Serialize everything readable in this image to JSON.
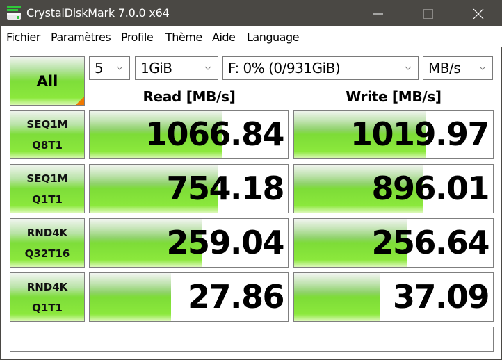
{
  "window": {
    "title": "CrystalDiskMark 7.0.0 x64",
    "controls": {
      "minimize": "minimize",
      "maximize": "maximize",
      "close": "close"
    }
  },
  "menu": [
    {
      "label": "Fichier",
      "accel": "F",
      "rest": "ichier"
    },
    {
      "label": "Paramètres",
      "accel": "P",
      "rest": "aramètres"
    },
    {
      "label": "Profile",
      "accel": "P",
      "rest": "rofile"
    },
    {
      "label": "Thème",
      "accel": "T",
      "rest": "hème"
    },
    {
      "label": "Aide",
      "accel": "A",
      "rest": "ide"
    },
    {
      "label": "Language",
      "accel": "L",
      "rest": "anguage"
    }
  ],
  "toolbar": {
    "all_button": "All",
    "test_count": "5",
    "test_size": "1GiB",
    "drive": "F: 0% (0/931GiB)",
    "unit": "MB/s"
  },
  "headers": {
    "read": "Read [MB/s]",
    "write": "Write [MB/s]"
  },
  "rows": [
    {
      "label_line1": "SEQ1M",
      "label_line2": "Q8T1",
      "read": "1066.84",
      "write": "1019.97",
      "read_fill": 0.67,
      "write_fill": 0.66
    },
    {
      "label_line1": "SEQ1M",
      "label_line2": "Q1T1",
      "read": "754.18",
      "write": "896.01",
      "read_fill": 0.65,
      "write_fill": 0.65
    },
    {
      "label_line1": "RND4K",
      "label_line2": "Q32T16",
      "read": "259.04",
      "write": "256.64",
      "read_fill": 0.57,
      "write_fill": 0.57
    },
    {
      "label_line1": "RND4K",
      "label_line2": "Q1T1",
      "read": "27.86",
      "write": "37.09",
      "read_fill": 0.41,
      "write_fill": 0.43
    }
  ],
  "comment": "",
  "colors": {
    "titlebar": "#4a4844",
    "bar_green": "#7ddc37",
    "corner_orange": "#f07800"
  }
}
